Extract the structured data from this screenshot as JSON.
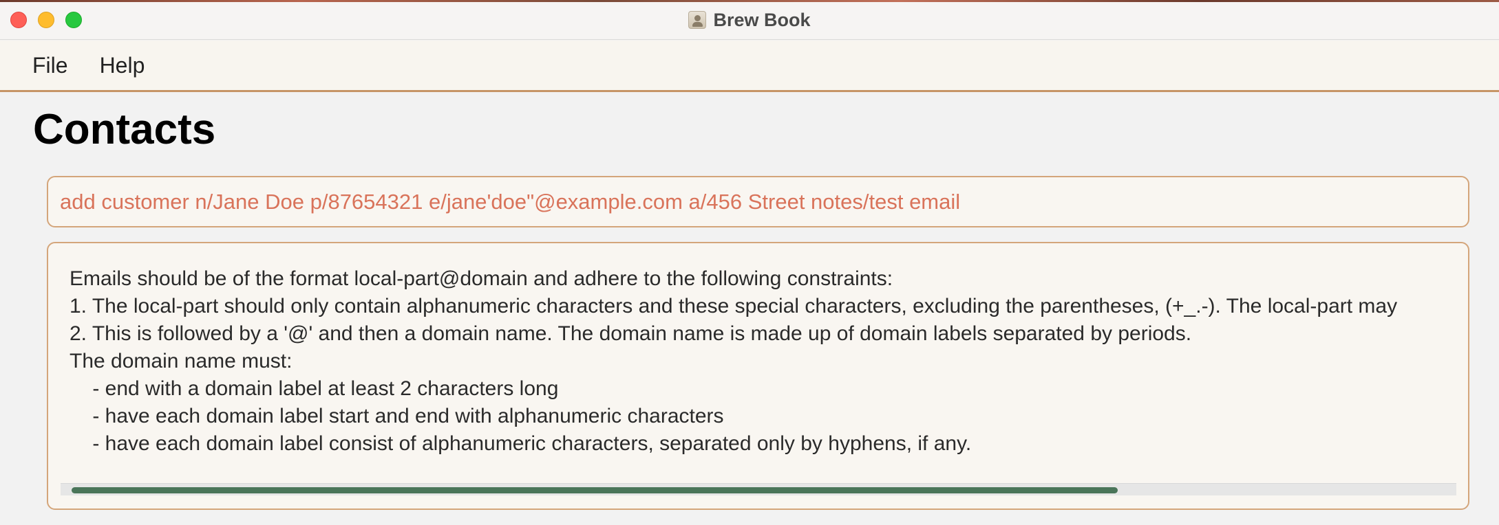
{
  "window": {
    "title": "Brew Book",
    "icon": "address-book-icon"
  },
  "menu": {
    "items": [
      "File",
      "Help"
    ]
  },
  "page": {
    "title": "Contacts"
  },
  "command": {
    "value": "add customer n/Jane Doe p/87654321 e/jane'doe\"@example.com a/456 Street notes/test email",
    "color": "#d9735a"
  },
  "result": {
    "lines": [
      "Emails should be of the format local-part@domain and adhere to the following constraints:",
      "1. The local-part should only contain alphanumeric characters and these special characters, excluding the parentheses, (+_.-). The local-part may",
      "2. This is followed by a '@' and then a domain name. The domain name is made up of domain labels separated by periods.",
      "The domain name must:",
      "    - end with a domain label at least 2 characters long",
      "    - have each domain label start and end with alphanumeric characters",
      "    - have each domain label consist of alphanumeric characters, separated only by hyphens, if any."
    ],
    "horizontal_scroll_fraction": 0.75,
    "accent": "#4a7559"
  },
  "colors": {
    "border_accent": "#c69566",
    "close": "#fe5f57",
    "minimize": "#febc2e",
    "maximize": "#28c840"
  }
}
